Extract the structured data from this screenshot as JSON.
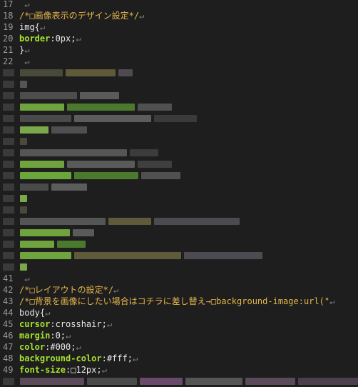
{
  "colors": {
    "background": "#1e1e1e",
    "comment": "#e5b54a",
    "property": "#a6e22e",
    "text": "#e6e6e6",
    "line_number": "#9a9a9a",
    "newline_marker": "#7f7f7f"
  },
  "newline_marker": "↵",
  "lines_top": [
    {
      "num": "17",
      "parts": [
        {
          "t": "",
          "c": "val"
        }
      ]
    },
    {
      "num": "18",
      "parts": [
        {
          "t": "/*□画像表示のデザイン設定*/",
          "c": "comment"
        }
      ]
    },
    {
      "num": "19",
      "parts": [
        {
          "t": "img{",
          "c": "val"
        }
      ]
    },
    {
      "num": "20",
      "parts": [
        {
          "t": "border",
          "c": "prop"
        },
        {
          "t": ":0px;",
          "c": "val"
        }
      ]
    },
    {
      "num": "21",
      "parts": [
        {
          "t": "}",
          "c": "val"
        }
      ]
    },
    {
      "num": "22",
      "parts": [
        {
          "t": "",
          "c": "val"
        }
      ]
    }
  ],
  "lines_bottom": [
    {
      "num": "41",
      "parts": [
        {
          "t": "",
          "c": "val"
        }
      ]
    },
    {
      "num": "42",
      "parts": [
        {
          "t": "/*□レイアウトの設定*/",
          "c": "comment"
        }
      ]
    },
    {
      "num": "43",
      "parts": [
        {
          "t": "/*□背景を画像にしたい場合はコチラに差し替え→□background-image:url(\"",
          "c": "comment"
        }
      ]
    },
    {
      "num": "44",
      "parts": [
        {
          "t": "body{",
          "c": "val"
        }
      ]
    },
    {
      "num": "45",
      "parts": [
        {
          "t": "cursor",
          "c": "prop"
        },
        {
          "t": ":crosshair;",
          "c": "val"
        }
      ]
    },
    {
      "num": "46",
      "parts": [
        {
          "t": "margin",
          "c": "prop"
        },
        {
          "t": ":0;",
          "c": "val"
        }
      ]
    },
    {
      "num": "47",
      "parts": [
        {
          "t": "color",
          "c": "prop"
        },
        {
          "t": ":#000;",
          "c": "val"
        }
      ]
    },
    {
      "num": "48",
      "parts": [
        {
          "t": "background-color",
          "c": "prop"
        },
        {
          "t": ":#fff;",
          "c": "val"
        }
      ]
    },
    {
      "num": "49",
      "parts": [
        {
          "t": "font-size",
          "c": "prop"
        },
        {
          "t": ":□12px;",
          "c": "val"
        }
      ]
    }
  ]
}
